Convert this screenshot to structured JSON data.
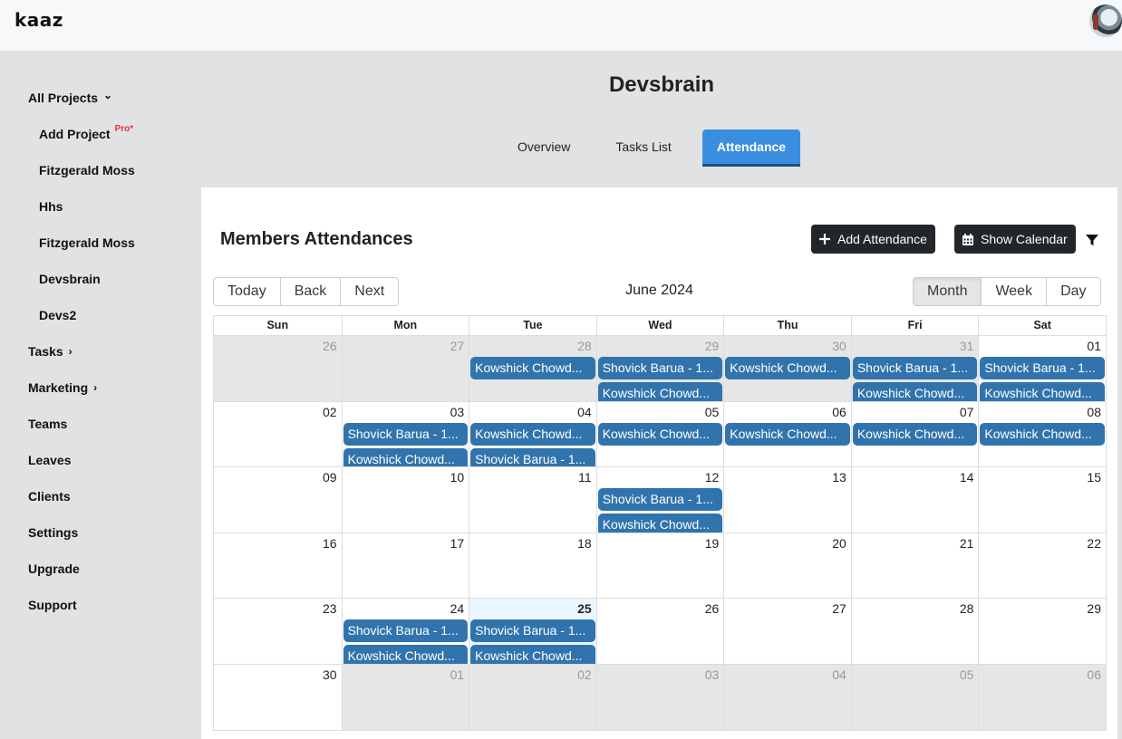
{
  "app": {
    "logo": "kaaz"
  },
  "sidebar": {
    "all_projects": "All Projects",
    "projects": [
      {
        "label": "Add Project",
        "badge": "Pro*"
      },
      {
        "label": "Fitzgerald Moss"
      },
      {
        "label": "Hhs"
      },
      {
        "label": "Fitzgerald Moss"
      },
      {
        "label": "Devsbrain"
      },
      {
        "label": "Devs2"
      }
    ],
    "items": [
      {
        "label": "Tasks",
        "chevron": "›"
      },
      {
        "label": "Marketing",
        "chevron": "›"
      },
      {
        "label": "Teams"
      },
      {
        "label": "Leaves"
      },
      {
        "label": "Clients"
      },
      {
        "label": "Settings"
      },
      {
        "label": "Upgrade"
      },
      {
        "label": "Support"
      }
    ],
    "chevron_down": "⌄"
  },
  "header": {
    "title": "Devsbrain"
  },
  "tabs": [
    {
      "label": "Overview",
      "active": false
    },
    {
      "label": "Tasks List",
      "active": false
    },
    {
      "label": "Attendance",
      "active": true
    }
  ],
  "panel": {
    "title": "Members Attendances",
    "add_button": "Add Attendance",
    "calendar_button": "Show Calendar"
  },
  "calendar": {
    "nav": [
      "Today",
      "Back",
      "Next"
    ],
    "label": "June 2024",
    "views": [
      {
        "label": "Month",
        "active": true
      },
      {
        "label": "Week",
        "active": false
      },
      {
        "label": "Day",
        "active": false
      }
    ],
    "weekdays": [
      "Sun",
      "Mon",
      "Tue",
      "Wed",
      "Thu",
      "Fri",
      "Sat"
    ],
    "weeks": [
      [
        {
          "day": "26",
          "off": true,
          "events": []
        },
        {
          "day": "27",
          "off": true,
          "events": []
        },
        {
          "day": "28",
          "off": true,
          "events": [
            "Kowshick Chowd..."
          ]
        },
        {
          "day": "29",
          "off": true,
          "events": [
            "Shovick Barua - 1...",
            "Kowshick Chowd..."
          ]
        },
        {
          "day": "30",
          "off": true,
          "events": [
            "Kowshick Chowd..."
          ]
        },
        {
          "day": "31",
          "off": true,
          "events": [
            "Shovick Barua - 1...",
            "Kowshick Chowd..."
          ]
        },
        {
          "day": "01",
          "off": false,
          "events": [
            "Shovick Barua - 1...",
            "Kowshick Chowd..."
          ]
        }
      ],
      [
        {
          "day": "02",
          "off": false,
          "events": []
        },
        {
          "day": "03",
          "off": false,
          "events": [
            "Shovick Barua - 1...",
            "Kowshick Chowd..."
          ]
        },
        {
          "day": "04",
          "off": false,
          "events": [
            "Kowshick Chowd...",
            "Shovick Barua - 1..."
          ]
        },
        {
          "day": "05",
          "off": false,
          "events": [
            "Kowshick Chowd..."
          ]
        },
        {
          "day": "06",
          "off": false,
          "events": [
            "Kowshick Chowd..."
          ]
        },
        {
          "day": "07",
          "off": false,
          "events": [
            "Kowshick Chowd..."
          ]
        },
        {
          "day": "08",
          "off": false,
          "events": [
            "Kowshick Chowd..."
          ]
        }
      ],
      [
        {
          "day": "09",
          "off": false,
          "events": []
        },
        {
          "day": "10",
          "off": false,
          "events": []
        },
        {
          "day": "11",
          "off": false,
          "events": []
        },
        {
          "day": "12",
          "off": false,
          "events": [
            "Shovick Barua - 1...",
            "Kowshick Chowd..."
          ]
        },
        {
          "day": "13",
          "off": false,
          "events": []
        },
        {
          "day": "14",
          "off": false,
          "events": []
        },
        {
          "day": "15",
          "off": false,
          "events": []
        }
      ],
      [
        {
          "day": "16",
          "off": false,
          "events": []
        },
        {
          "day": "17",
          "off": false,
          "events": []
        },
        {
          "day": "18",
          "off": false,
          "events": []
        },
        {
          "day": "19",
          "off": false,
          "events": []
        },
        {
          "day": "20",
          "off": false,
          "events": []
        },
        {
          "day": "21",
          "off": false,
          "events": []
        },
        {
          "day": "22",
          "off": false,
          "events": []
        }
      ],
      [
        {
          "day": "23",
          "off": false,
          "events": []
        },
        {
          "day": "24",
          "off": false,
          "events": [
            "Shovick Barua - 1...",
            "Kowshick Chowd..."
          ]
        },
        {
          "day": "25",
          "off": false,
          "today": true,
          "events": [
            "Shovick Barua - 1...",
            "Kowshick Chowd..."
          ]
        },
        {
          "day": "26",
          "off": false,
          "events": []
        },
        {
          "day": "27",
          "off": false,
          "events": []
        },
        {
          "day": "28",
          "off": false,
          "events": []
        },
        {
          "day": "29",
          "off": false,
          "events": []
        }
      ],
      [
        {
          "day": "30",
          "off": false,
          "events": []
        },
        {
          "day": "01",
          "off": true,
          "events": []
        },
        {
          "day": "02",
          "off": true,
          "events": []
        },
        {
          "day": "03",
          "off": true,
          "events": []
        },
        {
          "day": "04",
          "off": true,
          "events": []
        },
        {
          "day": "05",
          "off": true,
          "events": []
        },
        {
          "day": "06",
          "off": true,
          "events": []
        }
      ]
    ]
  },
  "colors": {
    "accent": "#3a8ee0",
    "event": "#3174ad",
    "dark_button": "#22262a",
    "pro_badge": "#e0343f",
    "today_bg": "#eaf6ff"
  }
}
